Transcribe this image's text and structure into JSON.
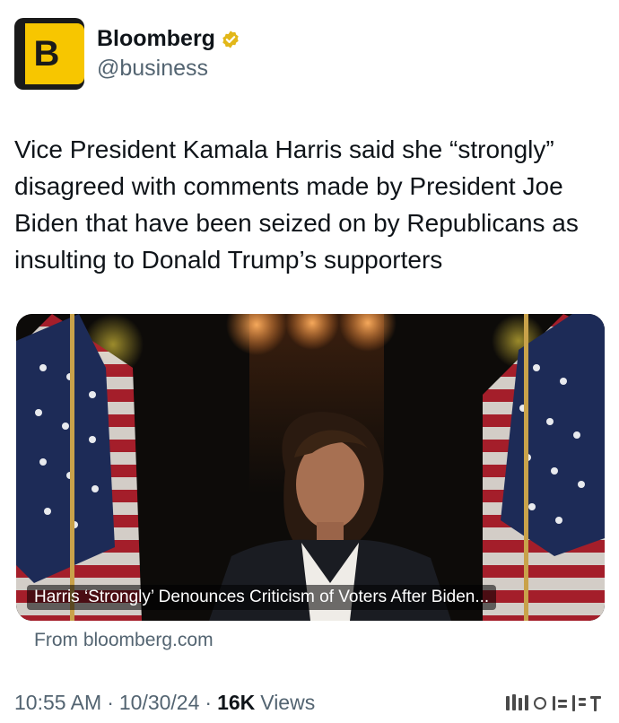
{
  "account": {
    "avatar_letter": "B",
    "display_name": "Bloomberg",
    "handle": "@business",
    "verified_icon": "gold-check-badge"
  },
  "tweet": {
    "text": "Vice President Kamala Harris said she “strongly” disagreed with comments made by President Joe Biden that have been seized on by Republicans as insulting to Donald Trump’s supporters"
  },
  "card": {
    "title": "Harris ‘Strongly’ Denounces Criticism of Voters After Biden...",
    "source": "From bloomberg.com"
  },
  "meta": {
    "time": "10:55 AM",
    "date": "10/30/24",
    "views_count": "16K",
    "views_label": "Views"
  },
  "colors": {
    "text": "#0f1419",
    "secondary": "#536471",
    "brand_yellow": "#f7c600"
  }
}
